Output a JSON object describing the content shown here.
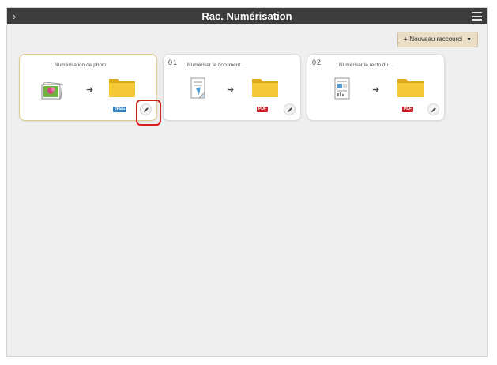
{
  "window": {
    "title": "Rac. Numérisation"
  },
  "toolbar": {
    "new_shortcut_label": "Nouveau raccourci"
  },
  "cards": [
    {
      "number": "",
      "title": "Numérisation de photo",
      "format": "JPEG",
      "source": "photo-icon",
      "selected": true
    },
    {
      "number": "01",
      "title": "Numériser le document...",
      "format": "PDF",
      "source": "document-icon",
      "selected": false
    },
    {
      "number": "02",
      "title": "Numériser le recto du ...",
      "format": "PDF",
      "source": "front-page-icon",
      "selected": false
    }
  ],
  "colors": {
    "titlebar": "#3c3c3c",
    "pdf_badge": "#c8242c",
    "jpeg_badge": "#2f7fc1",
    "folder": "#f2c230",
    "highlight": "#d41f1f"
  }
}
